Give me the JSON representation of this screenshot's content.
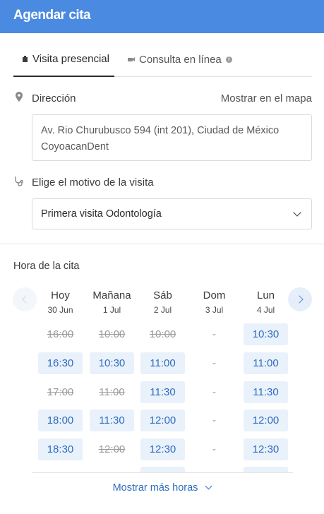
{
  "header": {
    "title": "Agendar cita"
  },
  "tabs": [
    {
      "label": "Visita presencial",
      "icon": "building-icon",
      "active": true
    },
    {
      "label": "Consulta en línea",
      "icon": "video-icon",
      "active": false
    }
  ],
  "address": {
    "label": "Dirección",
    "map_link": "Mostrar en el mapa",
    "line1": "Av. Rio Churubusco 594 (int 201), Ciudad de México",
    "line2": "CoyoacanDent"
  },
  "reason": {
    "label": "Elige el motivo de la visita",
    "selected": "Primera visita Odontología"
  },
  "schedule": {
    "label": "Hora de la cita",
    "more_label": "Mostrar más horas",
    "days": [
      {
        "name": "Hoy",
        "date": "30 Jun",
        "slots": [
          {
            "t": "16:00",
            "s": "taken"
          },
          {
            "t": "16:30",
            "s": "avail"
          },
          {
            "t": "17:00",
            "s": "taken"
          },
          {
            "t": "18:00",
            "s": "avail"
          },
          {
            "t": "18:30",
            "s": "avail"
          },
          {
            "t": "",
            "s": "none"
          }
        ]
      },
      {
        "name": "Mañana",
        "date": "1 Jul",
        "slots": [
          {
            "t": "10:00",
            "s": "taken"
          },
          {
            "t": "10:30",
            "s": "avail"
          },
          {
            "t": "11:00",
            "s": "taken"
          },
          {
            "t": "11:30",
            "s": "avail"
          },
          {
            "t": "12:00",
            "s": "taken"
          },
          {
            "t": "",
            "s": "none"
          }
        ]
      },
      {
        "name": "Sáb",
        "date": "2 Jul",
        "slots": [
          {
            "t": "10:00",
            "s": "taken"
          },
          {
            "t": "11:00",
            "s": "avail"
          },
          {
            "t": "11:30",
            "s": "avail"
          },
          {
            "t": "12:00",
            "s": "avail"
          },
          {
            "t": "12:30",
            "s": "avail"
          },
          {
            "t": "",
            "s": "avail"
          }
        ]
      },
      {
        "name": "Dom",
        "date": "3 Jul",
        "slots": [
          {
            "t": "-",
            "s": "none"
          },
          {
            "t": "-",
            "s": "none"
          },
          {
            "t": "-",
            "s": "none"
          },
          {
            "t": "-",
            "s": "none"
          },
          {
            "t": "-",
            "s": "none"
          }
        ]
      },
      {
        "name": "Lun",
        "date": "4 Jul",
        "slots": [
          {
            "t": "10:30",
            "s": "avail"
          },
          {
            "t": "11:00",
            "s": "avail"
          },
          {
            "t": "11:30",
            "s": "avail"
          },
          {
            "t": "12:00",
            "s": "avail"
          },
          {
            "t": "12:30",
            "s": "avail"
          },
          {
            "t": "",
            "s": "avail"
          }
        ]
      }
    ]
  },
  "colors": {
    "header": "#4a8ae0",
    "slot_bg": "#e9f1fb",
    "slot_text": "#2f6cbf"
  }
}
